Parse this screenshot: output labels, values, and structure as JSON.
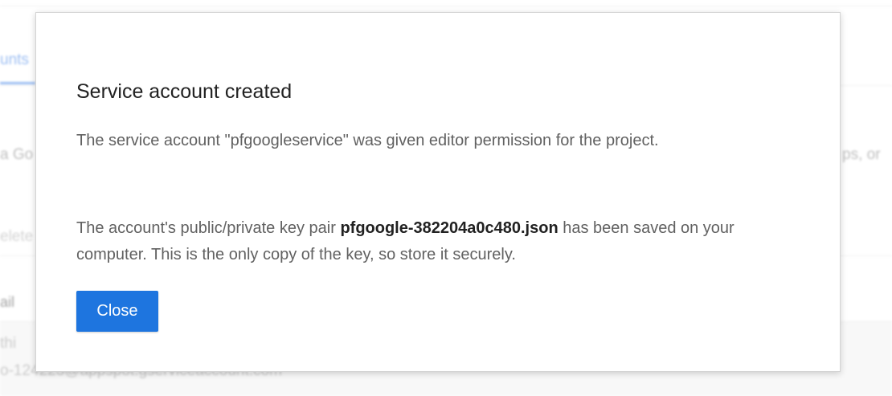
{
  "background": {
    "tab_label": "unts",
    "left_text": "a Go",
    "right_text": "ps, or",
    "delete_label": "elete",
    "email_header": "ail",
    "row_line1": "thi",
    "row_line2": "o-124223@appspot.gserviceaccount.com"
  },
  "dialog": {
    "title": "Service account created",
    "para1": "The service account \"pfgoogleservice\" was given editor permission for the project.",
    "para2_prefix": "The account's public/private key pair ",
    "para2_filename": "pfgoogle-382204a0c480.json",
    "para2_suffix": " has been saved on your computer. This is the only copy of the key, so store it securely.",
    "close_label": "Close"
  },
  "colors": {
    "primary_button": "#1e75df",
    "tab_accent": "#4a88e8"
  }
}
